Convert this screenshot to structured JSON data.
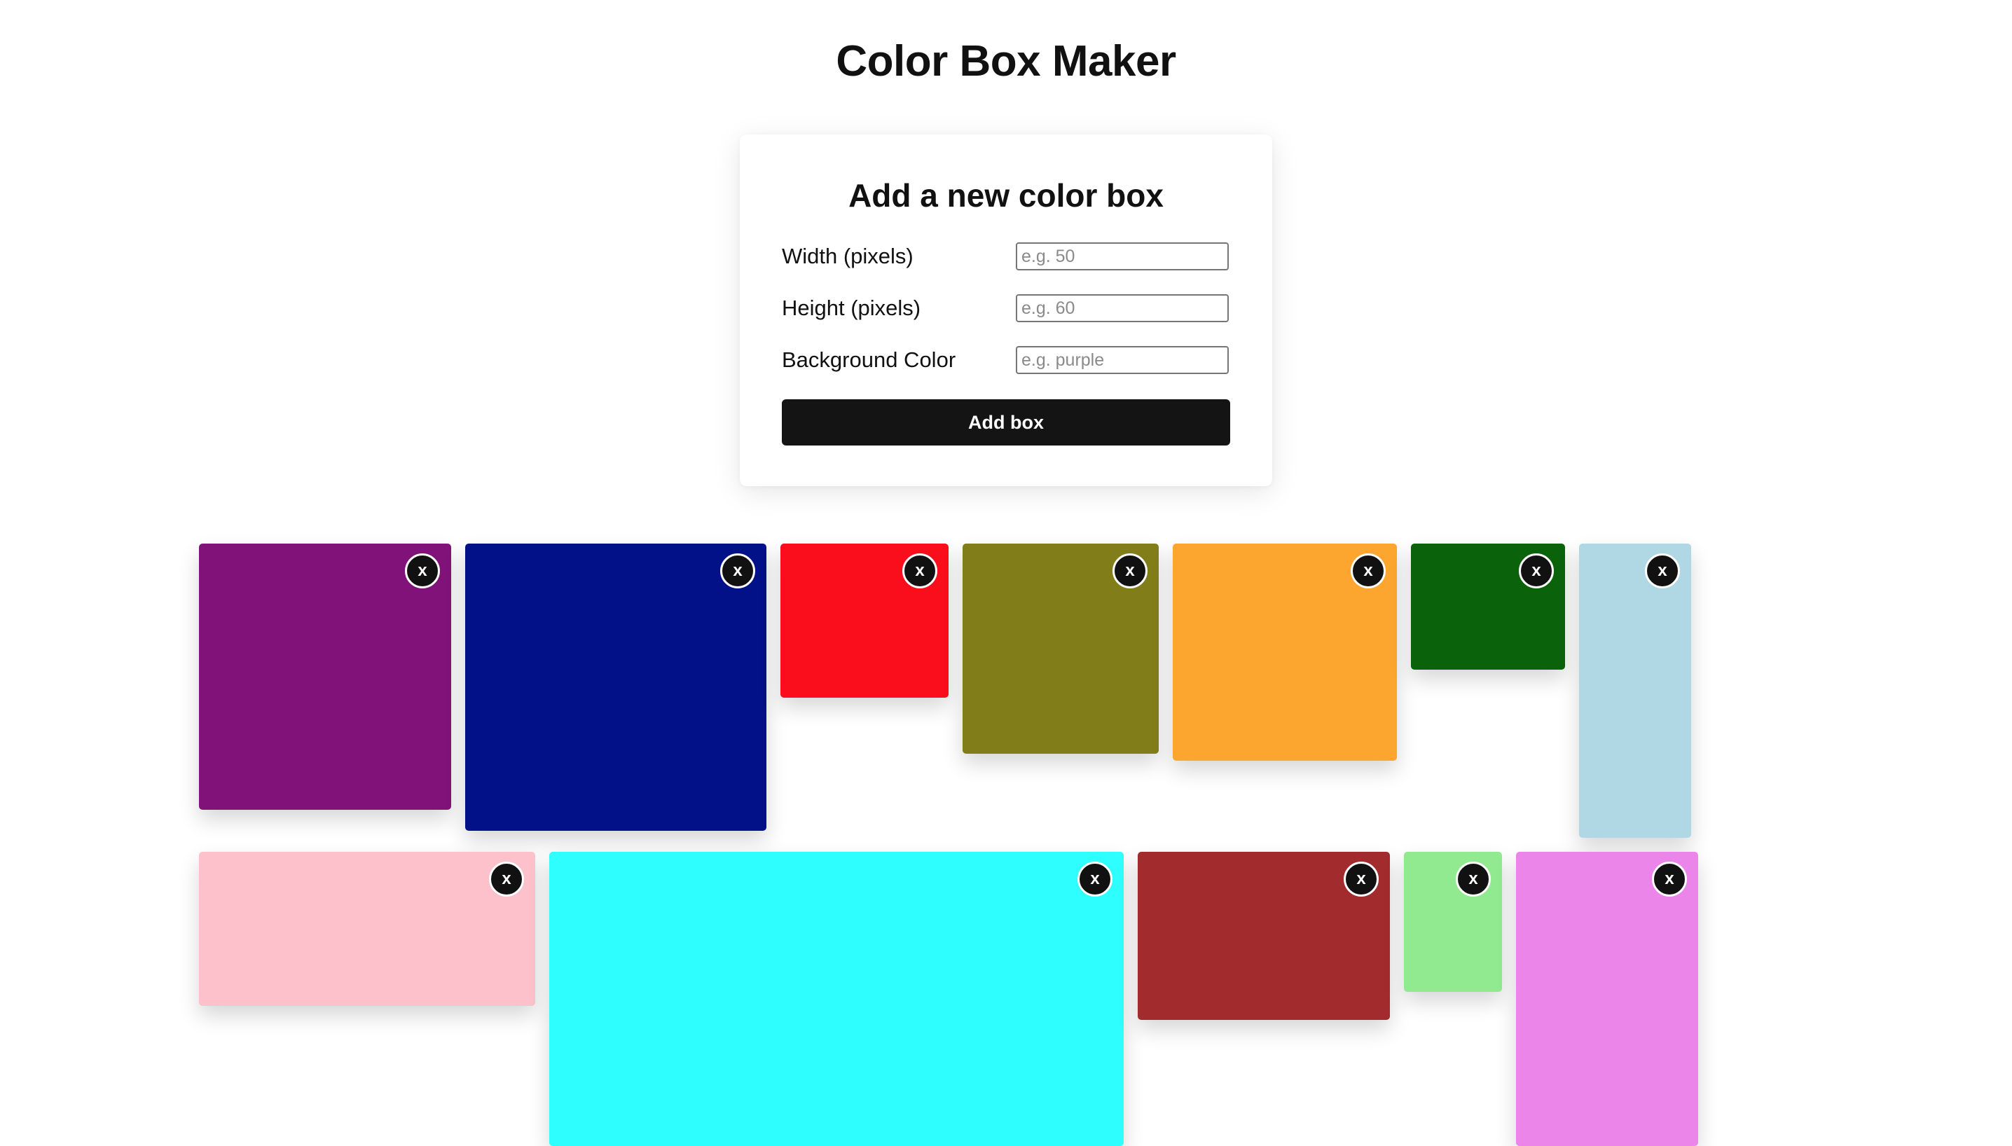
{
  "page": {
    "title": "Color Box Maker"
  },
  "form": {
    "title": "Add a new color box",
    "width_label": "Width (pixels)",
    "width_placeholder": "e.g. 50",
    "height_label": "Height (pixels)",
    "height_placeholder": "e.g. 60",
    "color_label": "Background Color",
    "color_placeholder": "e.g. purple",
    "submit_label": "Add box"
  },
  "boxes": [
    {
      "name": "purple",
      "color": "#801279",
      "remove_label": "x"
    },
    {
      "name": "navy",
      "color": "#021187",
      "remove_label": "x"
    },
    {
      "name": "red",
      "color": "#fb0e1c",
      "remove_label": "x"
    },
    {
      "name": "olive",
      "color": "#817e19",
      "remove_label": "x"
    },
    {
      "name": "orange",
      "color": "#fca52f",
      "remove_label": "x"
    },
    {
      "name": "dark-green",
      "color": "#0a620a",
      "remove_label": "x"
    },
    {
      "name": "light-blue",
      "color": "#b0d8e4",
      "remove_label": "x"
    },
    {
      "name": "pink",
      "color": "#fcc1cb",
      "remove_label": "x"
    },
    {
      "name": "cyan",
      "color": "#2efefe",
      "remove_label": "x"
    },
    {
      "name": "brown",
      "color": "#a22b2d",
      "remove_label": "x"
    },
    {
      "name": "light-green",
      "color": "#91e990",
      "remove_label": "x"
    },
    {
      "name": "violet",
      "color": "#ec85ea",
      "remove_label": "x"
    }
  ]
}
